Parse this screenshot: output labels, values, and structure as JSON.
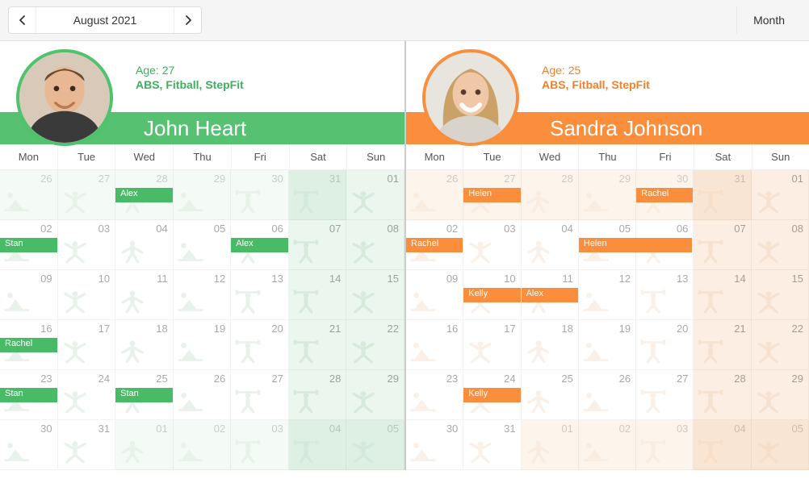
{
  "toolbar": {
    "month_label": "August 2021",
    "view_label": "Month"
  },
  "dow": [
    "Mon",
    "Tue",
    "Wed",
    "Thu",
    "Fri",
    "Sat",
    "Sun"
  ],
  "fitness_icons": [
    "situp",
    "stretch",
    "jump",
    "situp",
    "barbell",
    "barbell",
    "stretch"
  ],
  "trainers": [
    {
      "key": "john",
      "name": "John Heart",
      "age_label": "Age: 27",
      "skills": "ABS, Fitball, StepFit",
      "accent": "#55c171"
    },
    {
      "key": "sandra",
      "name": "Sandra Johnson",
      "age_label": "Age: 25",
      "skills": "ABS, Fitball, StepFit",
      "accent": "#fa8e3c"
    }
  ],
  "weeks": [
    [
      {
        "d": "26",
        "out": true,
        "we": false
      },
      {
        "d": "27",
        "out": true,
        "we": false
      },
      {
        "d": "28",
        "out": true,
        "we": false
      },
      {
        "d": "29",
        "out": true,
        "we": false
      },
      {
        "d": "30",
        "out": true,
        "we": false
      },
      {
        "d": "31",
        "out": true,
        "we": true
      },
      {
        "d": "01",
        "out": false,
        "we": true
      }
    ],
    [
      {
        "d": "02",
        "out": false,
        "we": false
      },
      {
        "d": "03",
        "out": false,
        "we": false
      },
      {
        "d": "04",
        "out": false,
        "we": false
      },
      {
        "d": "05",
        "out": false,
        "we": false
      },
      {
        "d": "06",
        "out": false,
        "we": false
      },
      {
        "d": "07",
        "out": false,
        "we": true
      },
      {
        "d": "08",
        "out": false,
        "we": true
      }
    ],
    [
      {
        "d": "09",
        "out": false,
        "we": false
      },
      {
        "d": "10",
        "out": false,
        "we": false
      },
      {
        "d": "11",
        "out": false,
        "we": false
      },
      {
        "d": "12",
        "out": false,
        "we": false
      },
      {
        "d": "13",
        "out": false,
        "we": false
      },
      {
        "d": "14",
        "out": false,
        "we": true
      },
      {
        "d": "15",
        "out": false,
        "we": true
      }
    ],
    [
      {
        "d": "16",
        "out": false,
        "we": false
      },
      {
        "d": "17",
        "out": false,
        "we": false
      },
      {
        "d": "18",
        "out": false,
        "we": false
      },
      {
        "d": "19",
        "out": false,
        "we": false
      },
      {
        "d": "20",
        "out": false,
        "we": false
      },
      {
        "d": "21",
        "out": false,
        "we": true
      },
      {
        "d": "22",
        "out": false,
        "we": true
      }
    ],
    [
      {
        "d": "23",
        "out": false,
        "we": false
      },
      {
        "d": "24",
        "out": false,
        "we": false
      },
      {
        "d": "25",
        "out": false,
        "we": false
      },
      {
        "d": "26",
        "out": false,
        "we": false
      },
      {
        "d": "27",
        "out": false,
        "we": false
      },
      {
        "d": "28",
        "out": false,
        "we": true
      },
      {
        "d": "29",
        "out": false,
        "we": true
      }
    ],
    [
      {
        "d": "30",
        "out": false,
        "we": false
      },
      {
        "d": "31",
        "out": false,
        "we": false
      },
      {
        "d": "01",
        "out": true,
        "we": false
      },
      {
        "d": "02",
        "out": true,
        "we": false
      },
      {
        "d": "03",
        "out": true,
        "we": false
      },
      {
        "d": "04",
        "out": true,
        "we": true
      },
      {
        "d": "05",
        "out": true,
        "we": true
      }
    ]
  ],
  "appointments": {
    "john": [
      {
        "week": 0,
        "col": 2,
        "span": 1,
        "label": "Alex"
      },
      {
        "week": 1,
        "col": 0,
        "span": 1,
        "label": "Stan"
      },
      {
        "week": 1,
        "col": 4,
        "span": 1,
        "label": "Alex"
      },
      {
        "week": 3,
        "col": 0,
        "span": 1,
        "label": "Rachel"
      },
      {
        "week": 4,
        "col": 0,
        "span": 1,
        "label": "Stan"
      },
      {
        "week": 4,
        "col": 2,
        "span": 1,
        "label": "Stan"
      }
    ],
    "sandra": [
      {
        "week": 0,
        "col": 1,
        "span": 1,
        "label": "Helen"
      },
      {
        "week": 0,
        "col": 4,
        "span": 1,
        "label": "Rachel"
      },
      {
        "week": 1,
        "col": 0,
        "span": 1,
        "label": "Rachel"
      },
      {
        "week": 1,
        "col": 3,
        "span": 2,
        "label": "Helen"
      },
      {
        "week": 2,
        "col": 1,
        "span": 1,
        "label": "Kelly"
      },
      {
        "week": 2,
        "col": 2,
        "span": 1,
        "label": "Alex"
      },
      {
        "week": 4,
        "col": 1,
        "span": 1,
        "label": "Kelly"
      }
    ]
  }
}
